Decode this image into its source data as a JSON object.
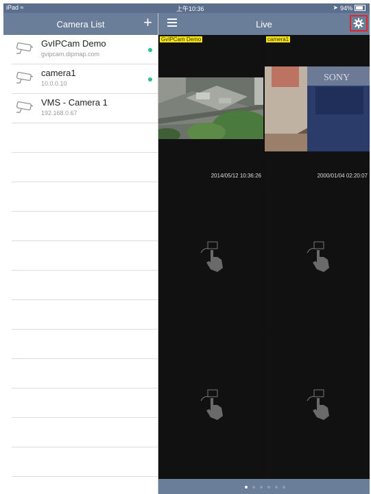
{
  "status_bar": {
    "carrier": "iPad",
    "time": "上午10:36",
    "battery": "94%"
  },
  "camera_list": {
    "title": "Camera List",
    "add_symbol": "+",
    "items": [
      {
        "name": "GvIPCam Demo",
        "address": "gvipcam.dipmap.com",
        "online": true
      },
      {
        "name": "camera1",
        "address": "10.0.0.10",
        "online": true
      },
      {
        "name": "VMS - Camera 1",
        "address": "192.168.0.67",
        "online": false
      }
    ]
  },
  "live": {
    "title": "Live",
    "cells": [
      {
        "label": "GvIPCam Demo",
        "timestamp": "2014/05/12 10:36:26"
      },
      {
        "label": "camera1",
        "timestamp": "2000/01/04 02:20:07"
      }
    ]
  },
  "colors": {
    "header": "#6b7e99",
    "status": "#5b6f8c",
    "online": "#27c28e",
    "label_bg": "#f7e30f",
    "highlight": "#e0262b"
  },
  "pager": {
    "pages": 6,
    "current": 1
  }
}
